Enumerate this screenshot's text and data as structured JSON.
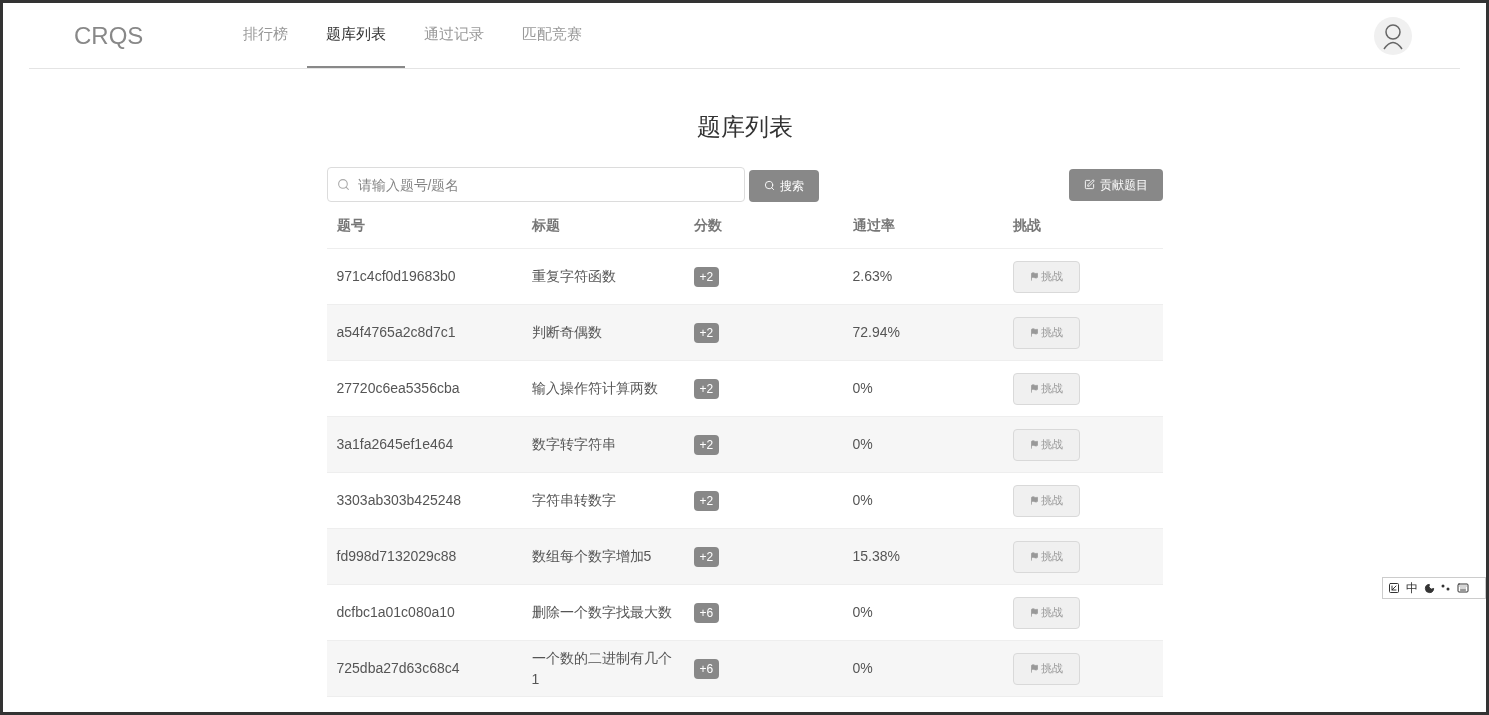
{
  "brand": "CRQS",
  "nav": [
    {
      "label": "排行榜",
      "selected": false
    },
    {
      "label": "题库列表",
      "selected": true
    },
    {
      "label": "通过记录",
      "selected": false
    },
    {
      "label": "匹配竞赛",
      "selected": false
    }
  ],
  "page_title": "题库列表",
  "search": {
    "placeholder": "请输入题号/题名",
    "button": "搜索"
  },
  "contribute_button": "贡献题目",
  "table": {
    "columns": [
      "题号",
      "标题",
      "分数",
      "通过率",
      "挑战"
    ],
    "rows": [
      {
        "id": "971c4cf0d19683b0",
        "title": "重复字符函数",
        "score": "+2",
        "rate": "2.63%",
        "action": "挑战"
      },
      {
        "id": "a54f4765a2c8d7c1",
        "title": "判断奇偶数",
        "score": "+2",
        "rate": "72.94%",
        "action": "挑战"
      },
      {
        "id": "27720c6ea5356cba",
        "title": "输入操作符计算两数",
        "score": "+2",
        "rate": "0%",
        "action": "挑战"
      },
      {
        "id": "3a1fa2645ef1e464",
        "title": "数字转字符串",
        "score": "+2",
        "rate": "0%",
        "action": "挑战"
      },
      {
        "id": "3303ab303b425248",
        "title": "字符串转数字",
        "score": "+2",
        "rate": "0%",
        "action": "挑战"
      },
      {
        "id": "fd998d7132029c88",
        "title": "数组每个数字增加5",
        "score": "+2",
        "rate": "15.38%",
        "action": "挑战"
      },
      {
        "id": "dcfbc1a01c080a10",
        "title": "删除一个数字找最大数",
        "score": "+6",
        "rate": "0%",
        "action": "挑战"
      },
      {
        "id": "725dba27d63c68c4",
        "title": "一个数的二进制有几个1",
        "score": "+6",
        "rate": "0%",
        "action": "挑战"
      }
    ]
  },
  "ime_toolbar": {
    "mode": "中"
  }
}
